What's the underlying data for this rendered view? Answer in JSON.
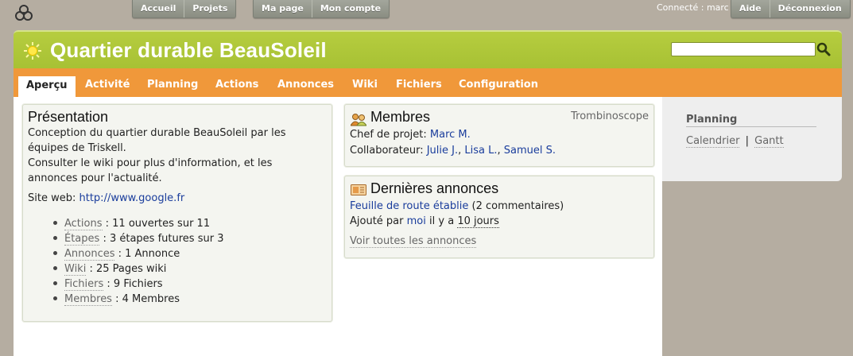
{
  "topnav": {
    "left_tabs": [
      "Accueil",
      "Projets"
    ],
    "middle_tabs": [
      "Ma page",
      "Mon compte"
    ],
    "connected_label": "Connecté : marc",
    "right_tabs": [
      "Aide",
      "Déconnexion"
    ]
  },
  "header": {
    "title": "Quartier durable BeauSoleil",
    "search_value": "",
    "accent_color": "#a7c134"
  },
  "tabs": [
    "Aperçu",
    "Activité",
    "Planning",
    "Actions",
    "Annonces",
    "Wiki",
    "Fichiers",
    "Configuration"
  ],
  "active_tab": "Aperçu",
  "presentation": {
    "title": "Présentation",
    "paragraph_lines": [
      "Conception du quartier durable BeauSoleil par les",
      "équipes de Triskell.",
      "Consulter le wiki pour plus d'information, et les",
      "annonces pour l'actualité."
    ],
    "site_label": "Site web:",
    "site_url": "http://www.google.fr",
    "stats": [
      {
        "link": "Actions",
        "text": ": 11 ouvertes sur 11"
      },
      {
        "link": "Étapes",
        "text": ": 3 étapes futures sur 3"
      },
      {
        "link": "Annonces",
        "text": ": 1 Annonce"
      },
      {
        "link": "Wiki",
        "text": ": 25 Pages wiki"
      },
      {
        "link": "Fichiers",
        "text": ": 9 Fichiers"
      },
      {
        "link": "Membres",
        "text": ": 4 Membres"
      }
    ]
  },
  "membres": {
    "title": "Membres",
    "trombino": "Trombinoscope",
    "chef_label": "Chef de projet:",
    "chef": "Marc M.",
    "collab_label": "Collaborateur:",
    "collaborators": [
      "Julie J.",
      "Lisa L.",
      "Samuel S."
    ],
    "sep": ","
  },
  "annonces": {
    "title": "Dernières annonces",
    "item_title": "Feuille de route établie",
    "item_comments": "(2 commentaires)",
    "added_prefix": "Ajouté par",
    "added_by": "moi",
    "added_mid": "il y a",
    "added_when": "10 jours",
    "see_all": "Voir toutes les annonces"
  },
  "sidebar": {
    "title": "Planning",
    "links": [
      "Calendrier",
      "Gantt"
    ],
    "sep": "|"
  }
}
